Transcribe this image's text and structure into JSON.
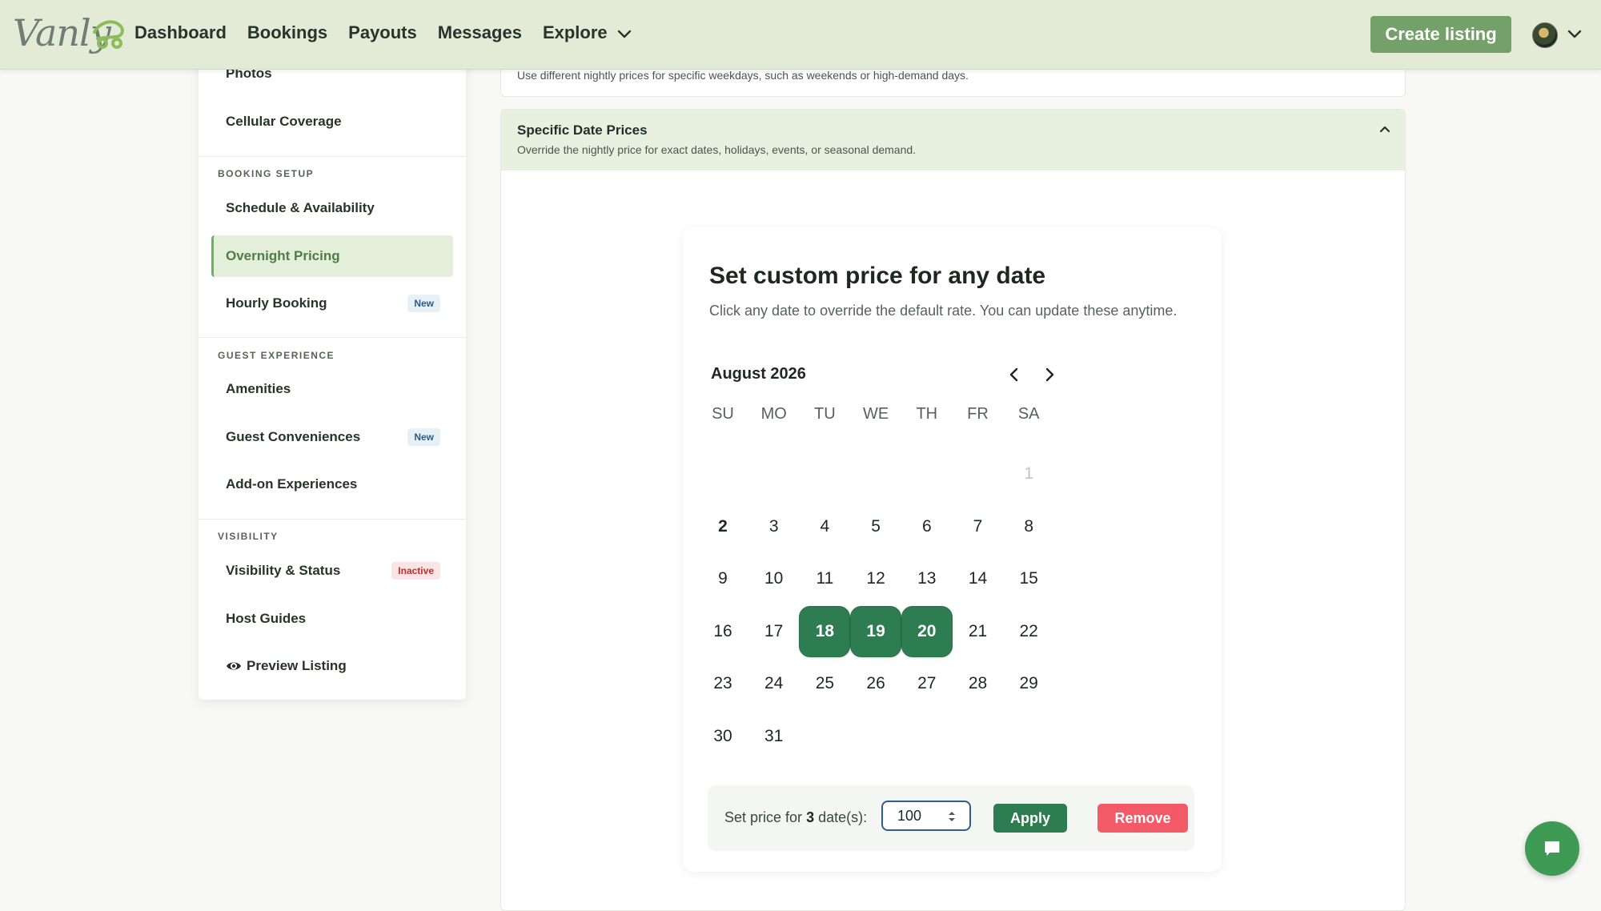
{
  "header": {
    "logo_text": "Vanly",
    "nav": [
      "Dashboard",
      "Bookings",
      "Payouts",
      "Messages",
      "Explore"
    ],
    "create_listing": "Create listing"
  },
  "sidebar": {
    "items_top": [
      "Photos",
      "Cellular Coverage"
    ],
    "booking_setup_label": "BOOKING SETUP",
    "booking_setup": [
      "Schedule & Availability",
      "Overnight Pricing",
      "Hourly Booking"
    ],
    "guest_experience_label": "GUEST EXPERIENCE",
    "guest_experience": [
      "Amenities",
      "Guest Conveniences",
      "Add-on Experiences"
    ],
    "visibility_label": "VISIBILITY",
    "visibility": [
      "Visibility & Status",
      "Host Guides",
      "Preview Listing"
    ],
    "badge_new": "New",
    "badge_inactive": "Inactive",
    "active_item": "Overnight Pricing"
  },
  "main": {
    "weekday_panel_desc": "Use different nightly prices for specific weekdays, such as weekends or high-demand days.",
    "specific_title": "Specific Date Prices",
    "specific_desc": "Override the nightly price for exact dates, holidays, events, or seasonal demand."
  },
  "calendar": {
    "title": "Set custom price for any date",
    "subtitle": "Click any date to override the default rate. You can update these anytime.",
    "month": "August 2026",
    "weekdays": [
      "SU",
      "MO",
      "TU",
      "WE",
      "TH",
      "FR",
      "SA"
    ],
    "first_weekday_index": 6,
    "days_in_month": 31,
    "muted_days": [
      1
    ],
    "today": 2,
    "selected_days": [
      18,
      19,
      20
    ],
    "price_prefix": "Set price for",
    "price_count": "3",
    "price_suffix": "date(s):",
    "price_value": "100",
    "apply": "Apply",
    "remove": "Remove"
  },
  "colors": {
    "header_bg": "#e3ebd7",
    "accent_green": "#2e7d52",
    "create_btn": "#74a06a",
    "remove_red": "#f15a66"
  }
}
